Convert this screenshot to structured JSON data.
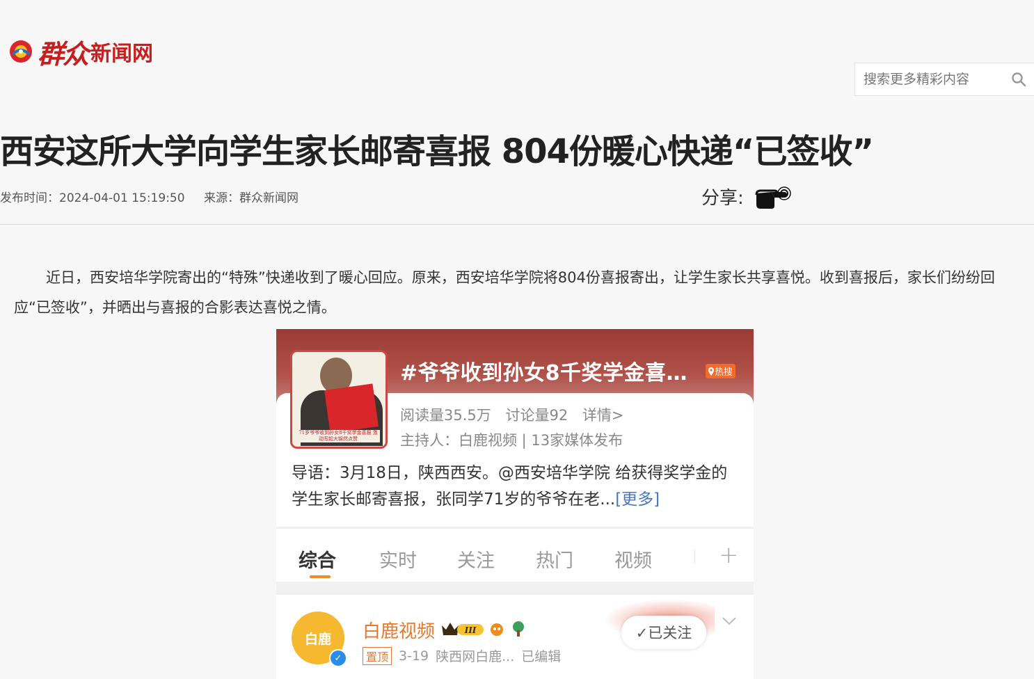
{
  "header": {
    "logo_calligraphy": "群众",
    "logo_text": "新闻网",
    "search_placeholder": "搜索更多精彩内容"
  },
  "article": {
    "title": "西安这所大学向学生家长邮寄喜报 804份暖心快递“已签收”",
    "publish_time": "发布时间：2024-04-01 15:19:50",
    "source": "来源：群众新闻网",
    "share_label": "分享:",
    "paragraph": "近日，西安培华学院寄出的“特殊”快递收到了暖心回应。原来，西安培华学院将804份喜报寄出，让学生家长共享喜悦。收到喜报后，家长们纷纷回应“已签收”，并晒出与喜报的合影表达喜悦之情。"
  },
  "embedded": {
    "topic": "#爷爷收到孙女8千奖学金喜…",
    "hot_badge": "热搜",
    "reads": "阅读量35.5万",
    "discussions": "讨论量92",
    "details": "详情>",
    "host": "主持人：白鹿视频 | 13家媒体发布",
    "intro": "导语：3月18日，陕西西安。@西安培华学院 给获得奖学金的学生家长邮寄喜报，张同学71岁的爷爷在老...",
    "intro_more": "[更多]",
    "thumb_caption": "71岁爷爷收到孙女8千奖学金喜报 激动写起大锦然点赞",
    "tabs": [
      "综合",
      "实时",
      "关注",
      "热门",
      "视频"
    ],
    "plus": "+",
    "post": {
      "avatar_text": "白鹿",
      "name": "白鹿视频",
      "level": "III",
      "pin": "置顶",
      "date": "3-19",
      "source": "陕西网白鹿...",
      "edited": "已编辑",
      "follow": "✓已关注"
    }
  }
}
